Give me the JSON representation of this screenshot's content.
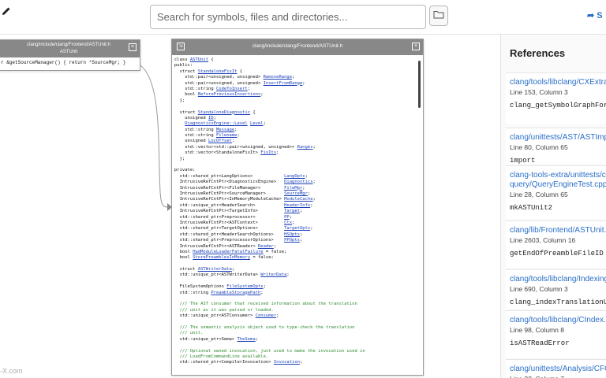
{
  "topbar": {
    "search_placeholder": "Search for symbols, files and directories...",
    "share_label": "S"
  },
  "left_node": {
    "title_line1": "clang/include/clang/Frontend/ASTUnit.h",
    "title_line2": "ASTUnit",
    "code": "r &getSourceManager() { return *SourceMgr; }"
  },
  "main_node": {
    "title": "clang/include/clang/Frontend/ASTUnit.h",
    "lines": [
      [
        [
          "class ",
          ""
        ],
        [
          "ASTUnit",
          "l"
        ],
        [
          " {",
          ""
        ]
      ],
      [
        [
          "public:",
          ""
        ]
      ],
      [
        [
          "  struct ",
          ""
        ],
        [
          "StandaloneFixIt",
          "l"
        ],
        [
          " {",
          ""
        ]
      ],
      [
        [
          "    std::pair<unsigned, unsigned> ",
          ""
        ],
        [
          "RemoveRange",
          "l"
        ],
        [
          ";",
          ""
        ]
      ],
      [
        [
          "    std::pair<unsigned, unsigned> ",
          ""
        ],
        [
          "InsertFromRange",
          "l"
        ],
        [
          ";",
          ""
        ]
      ],
      [
        [
          "    std::string ",
          ""
        ],
        [
          "CodeToInsert",
          "l"
        ],
        [
          ";",
          ""
        ]
      ],
      [
        [
          "    bool ",
          ""
        ],
        [
          "BeforePreviousInsertions",
          "l"
        ],
        [
          ";",
          ""
        ]
      ],
      [
        [
          "  };",
          ""
        ]
      ],
      [
        [
          "",
          ""
        ]
      ],
      [
        [
          "  struct ",
          ""
        ],
        [
          "StandaloneDiagnostic",
          "l"
        ],
        [
          " {",
          ""
        ]
      ],
      [
        [
          "    unsigned ",
          ""
        ],
        [
          "ID",
          "l"
        ],
        [
          ";",
          ""
        ]
      ],
      [
        [
          "    ",
          ""
        ],
        [
          "DiagnosticsEngine::Level",
          "l"
        ],
        [
          " ",
          ""
        ],
        [
          "Level",
          "l"
        ],
        [
          ";",
          ""
        ]
      ],
      [
        [
          "    std::string ",
          ""
        ],
        [
          "Message",
          "l"
        ],
        [
          ";",
          ""
        ]
      ],
      [
        [
          "    std::string ",
          ""
        ],
        [
          "Filename",
          "l"
        ],
        [
          ";",
          ""
        ]
      ],
      [
        [
          "    unsigned ",
          ""
        ],
        [
          "LocOffset",
          "l"
        ],
        [
          ";",
          ""
        ]
      ],
      [
        [
          "    std::vector<std::pair<unsigned, unsigned>> ",
          ""
        ],
        [
          "Ranges",
          "l"
        ],
        [
          ";",
          ""
        ]
      ],
      [
        [
          "    std::vector<StandaloneFixIt> ",
          ""
        ],
        [
          "FixIts",
          "l"
        ],
        [
          ";",
          ""
        ]
      ],
      [
        [
          "  };",
          ""
        ]
      ],
      [
        [
          "",
          ""
        ]
      ],
      [
        [
          "private:",
          ""
        ]
      ],
      [
        [
          "  std::shared_ptr<LangOptions>            ",
          ""
        ],
        [
          "LangOpts",
          "l"
        ],
        [
          ";",
          ""
        ]
      ],
      [
        [
          "  IntrusiveRefCntPtr<DiagnosticsEngine>   ",
          ""
        ],
        [
          "Diagnostics",
          "l"
        ],
        [
          ";",
          ""
        ]
      ],
      [
        [
          "  IntrusiveRefCntPtr<FileManager>         ",
          ""
        ],
        [
          "FileMgr",
          "l"
        ],
        [
          ";",
          ""
        ]
      ],
      [
        [
          "  IntrusiveRefCntPtr<SourceManager>       ",
          ""
        ],
        [
          "SourceMgr",
          "l"
        ],
        [
          ";",
          ""
        ]
      ],
      [
        [
          "  IntrusiveRefCntPtr<InMemoryModuleCache> ",
          ""
        ],
        [
          "ModuleCache",
          "l"
        ],
        [
          ";",
          ""
        ]
      ],
      [
        [
          "  std::unique_ptr<HeaderSearch>           ",
          ""
        ],
        [
          "HeaderInfo",
          "l"
        ],
        [
          ";",
          ""
        ]
      ],
      [
        [
          "  IntrusiveRefCntPtr<TargetInfo>          ",
          ""
        ],
        [
          "Target",
          "l"
        ],
        [
          ";",
          ""
        ]
      ],
      [
        [
          "  std::shared_ptr<Preprocessor>           ",
          ""
        ],
        [
          "PP",
          "l"
        ],
        [
          ";",
          ""
        ]
      ],
      [
        [
          "  IntrusiveRefCntPtr<ASTContext>          ",
          ""
        ],
        [
          "Ctx",
          "l"
        ],
        [
          ";",
          ""
        ]
      ],
      [
        [
          "  std::shared_ptr<TargetOptions>          ",
          ""
        ],
        [
          "TargetOpts",
          "l"
        ],
        [
          ";",
          ""
        ]
      ],
      [
        [
          "  std::shared_ptr<HeaderSearchOptions>    ",
          ""
        ],
        [
          "HSOpts",
          "l"
        ],
        [
          ";",
          ""
        ]
      ],
      [
        [
          "  std::shared_ptr<PreprocessorOptions>    ",
          ""
        ],
        [
          "PPOpts",
          "l"
        ],
        [
          ";",
          ""
        ]
      ],
      [
        [
          "  IntrusiveRefCntPtr<ASTReader> ",
          ""
        ],
        [
          "Reader",
          "l"
        ],
        [
          ";",
          ""
        ]
      ],
      [
        [
          "  bool ",
          ""
        ],
        [
          "HadModuleLoaderFatalFailure",
          "l"
        ],
        [
          " = false;",
          ""
        ]
      ],
      [
        [
          "  bool ",
          ""
        ],
        [
          "StorePreamblesInMemory",
          "l"
        ],
        [
          " = false;",
          ""
        ]
      ],
      [
        [
          "",
          ""
        ]
      ],
      [
        [
          "  struct ",
          ""
        ],
        [
          "ASTWriterData",
          "l"
        ],
        [
          ";",
          ""
        ]
      ],
      [
        [
          "  std::unique_ptr<ASTWriterData> ",
          ""
        ],
        [
          "WriterData",
          "l"
        ],
        [
          ";",
          ""
        ]
      ],
      [
        [
          "",
          ""
        ]
      ],
      [
        [
          "  FileSystemOptions ",
          ""
        ],
        [
          "FileSystemOpts",
          "l"
        ],
        [
          ";",
          ""
        ]
      ],
      [
        [
          "  std::string ",
          ""
        ],
        [
          "PreambleStoragePath",
          "l"
        ],
        [
          ";",
          ""
        ]
      ],
      [
        [
          "",
          ""
        ]
      ],
      [
        [
          "  /// The AST consumer that received information about the translation",
          "c"
        ]
      ],
      [
        [
          "  /// unit as it was parsed or loaded.",
          "c"
        ]
      ],
      [
        [
          "  std::unique_ptr<ASTConsumer> ",
          ""
        ],
        [
          "Consumer",
          "l"
        ],
        [
          ";",
          ""
        ]
      ],
      [
        [
          "",
          ""
        ]
      ],
      [
        [
          "  /// The semantic analysis object used to type-check the translation",
          "c"
        ]
      ],
      [
        [
          "  /// unit.",
          "c"
        ]
      ],
      [
        [
          "  std::unique_ptr<Sema> ",
          ""
        ],
        [
          "TheSema",
          "l"
        ],
        [
          ";",
          ""
        ]
      ],
      [
        [
          "",
          ""
        ]
      ],
      [
        [
          "  /// Optional owned invocation, just used to make the invocation used in",
          "c"
        ]
      ],
      [
        [
          "  /// LoadFromCommandLine available.",
          "c"
        ]
      ],
      [
        [
          "  std::shared_ptr<CompilerInvocation> ",
          ""
        ],
        [
          "Invocation",
          "l"
        ],
        [
          ";",
          ""
        ]
      ]
    ]
  },
  "watermark": "-X.com",
  "references": {
    "title": "References",
    "items": [
      {
        "path": "clang/tools/libclang/CXExtra",
        "loc": "Line 153, Column 3",
        "code": "clang_getSymbolGraphFor"
      },
      {
        "path": "clang/unittests/AST/ASTImpo",
        "loc": "Line 80, Column 65",
        "code": "import"
      },
      {
        "path": "clang-tools-extra/unittests/c",
        "path2": "query/QueryEngineTest.cpp",
        "loc": "Line 28, Column 65",
        "code": "mkASTUnit2"
      },
      {
        "path": "clang/lib/Frontend/ASTUnit.c",
        "loc": "Line 2603, Column 16",
        "code": "getEndOfPreambleFileID"
      },
      {
        "path": "clang/tools/libclang/Indexing",
        "loc": "Line 690, Column 3",
        "code": "clang_indexTranslationU"
      },
      {
        "path": "clang/tools/libclang/CIndex.c",
        "loc": "Line 98, Column 8",
        "code": "isASTReadError"
      },
      {
        "path": "clang/unittests/Analysis/CFG",
        "loc": "Line 22, Column 7",
        "code": ""
      }
    ]
  }
}
